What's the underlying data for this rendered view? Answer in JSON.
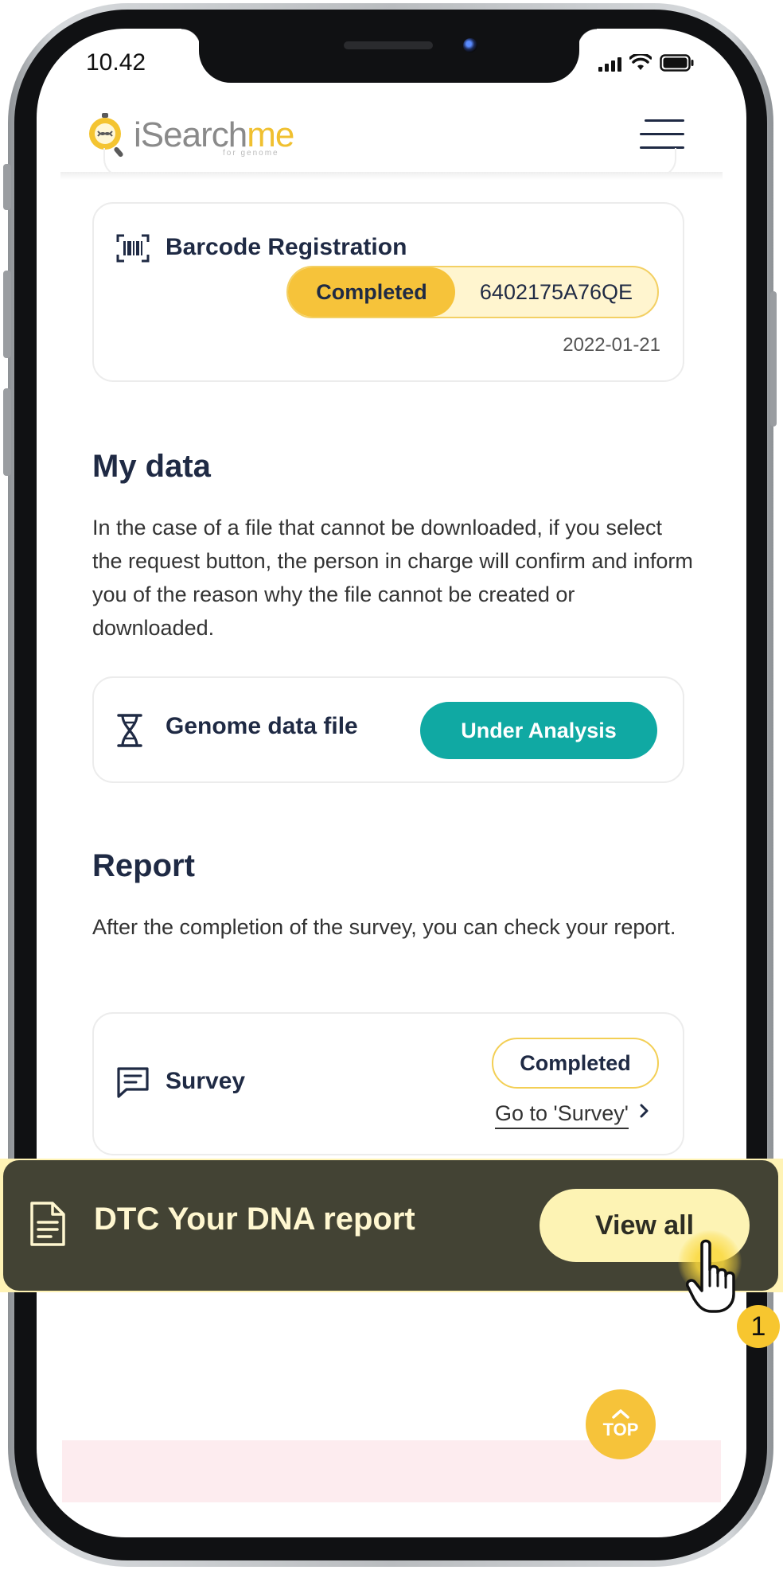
{
  "status_bar": {
    "time": "10.42"
  },
  "header": {
    "logo_text_main": "iSearch",
    "logo_text_accent": "me",
    "logo_subtext": "for genome"
  },
  "barcode_card": {
    "title": "Barcode Registration",
    "status": "Completed",
    "code": "6402175A76QE",
    "date": "2022-01-21"
  },
  "my_data": {
    "title": "My data",
    "description": "In the case of a file that cannot be downloaded, if you select the request button, the person in charge will confirm and inform you of the reason why the file cannot be created or downloaded.",
    "file_card": {
      "title": "Genome data file",
      "status_button": "Under Analysis"
    }
  },
  "report": {
    "title": "Report",
    "description": "After the completion of the survey, you can check your report.",
    "survey_card": {
      "title": "Survey",
      "status": "Completed",
      "link": "Go to 'Survey'"
    }
  },
  "report_bar": {
    "title": "DTC Your DNA report",
    "button": "View all"
  },
  "annotation": {
    "step_number": "1"
  },
  "top_button": {
    "label": "TOP"
  },
  "colors": {
    "accent_yellow": "#f6c33a",
    "teal": "#10a9a3",
    "navy": "#1f2a44",
    "report_bar": "#434334"
  },
  "icons": [
    "barcode-icon",
    "dna-icon",
    "chat-icon",
    "document-icon",
    "menu-icon",
    "hand-cursor-icon"
  ]
}
